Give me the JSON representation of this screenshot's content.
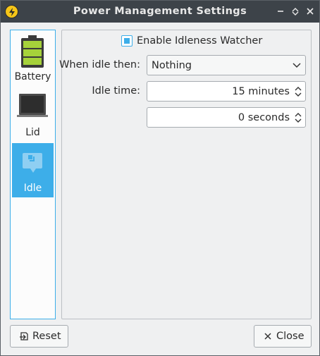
{
  "window": {
    "title": "Power Management Settings"
  },
  "titlebar_icons": [
    "app-power-icon",
    "minimize-icon",
    "maximize-icon",
    "close-icon"
  ],
  "sidebar": {
    "items": [
      {
        "label": "Battery",
        "icon": "battery-icon",
        "active": false
      },
      {
        "label": "Lid",
        "icon": "laptop-lid-icon",
        "active": false
      },
      {
        "label": "Idle",
        "icon": "idle-icon",
        "active": true
      }
    ]
  },
  "idle_panel": {
    "enable_label": "Enable Idleness Watcher",
    "enable_checked": true,
    "when_idle_label": "When idle then:",
    "when_idle_value": "Nothing",
    "idle_time_label": "Idle time:",
    "idle_minutes_value": "15 minutes",
    "idle_seconds_value": "0 seconds"
  },
  "buttons": {
    "reset": "Reset",
    "close": "Close"
  },
  "colors": {
    "accent": "#3daee9",
    "titlebar": "#3d4349",
    "battery_green": "#a6d23a"
  }
}
